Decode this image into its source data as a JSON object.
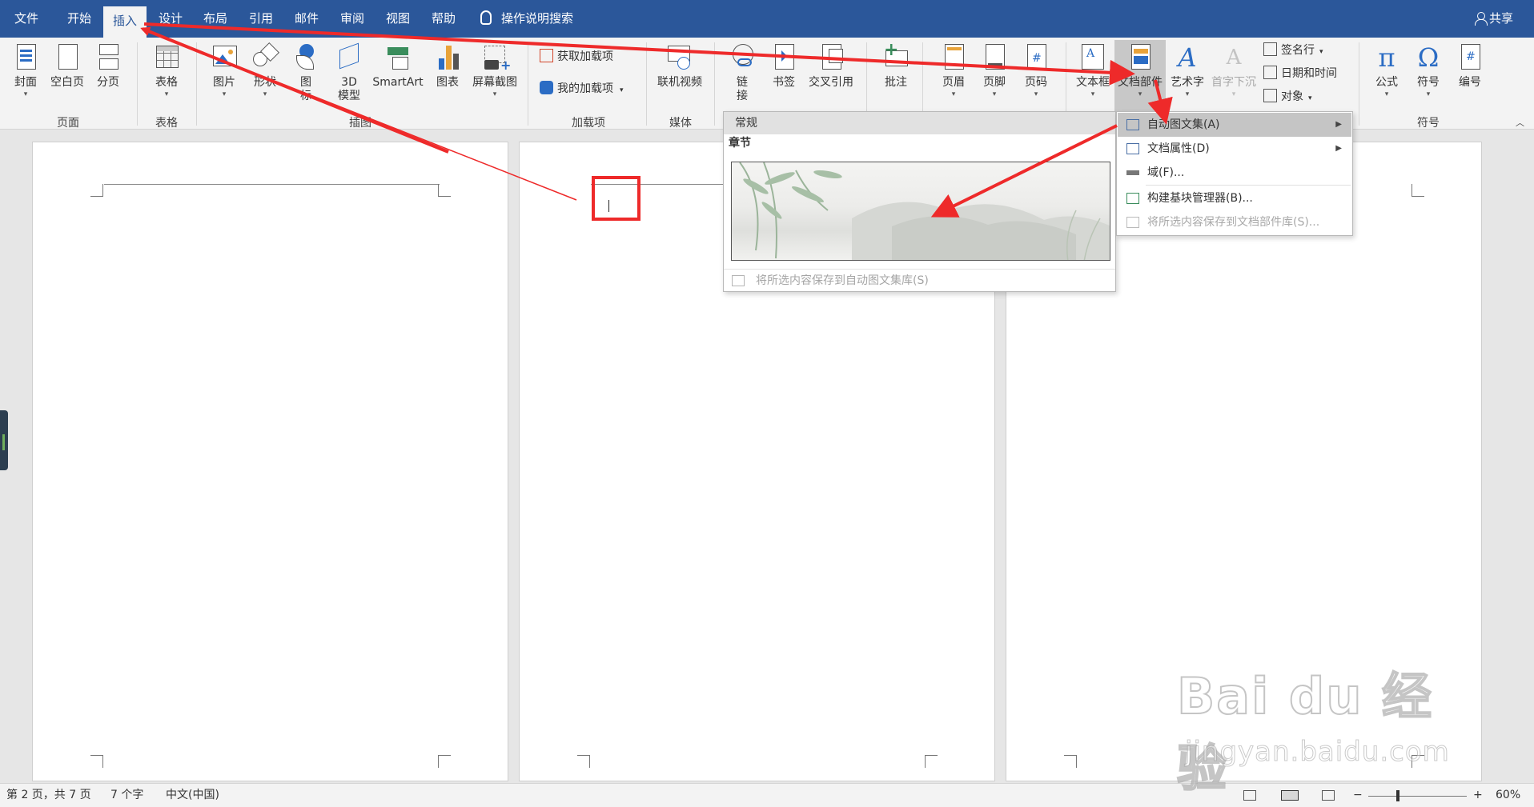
{
  "tabs": [
    {
      "label": "文件",
      "active": false
    },
    {
      "label": "开始",
      "active": false
    },
    {
      "label": "插入",
      "active": true
    },
    {
      "label": "设计",
      "active": false
    },
    {
      "label": "布局",
      "active": false
    },
    {
      "label": "引用",
      "active": false
    },
    {
      "label": "邮件",
      "active": false
    },
    {
      "label": "审阅",
      "active": false
    },
    {
      "label": "视图",
      "active": false
    },
    {
      "label": "帮助",
      "active": false
    }
  ],
  "search_label": "操作说明搜索",
  "share_label": "共享",
  "ribbon": {
    "groups": [
      "页面",
      "表格",
      "插图",
      "加载项",
      "媒体",
      "符号"
    ],
    "buttons": {
      "cover": "封面",
      "blank": "空白页",
      "pagebreak": "分页",
      "table": "表格",
      "picture": "图片",
      "shapes": "形状",
      "icons": "图标",
      "model3d": "3D模型",
      "smartart": "SmartArt",
      "chart": "图表",
      "screenshot": "屏幕截图",
      "get_addins": "获取加载项",
      "my_addins": "我的加载项",
      "online_video": "联机视频",
      "link": "链接",
      "bookmark": "书签",
      "crossref": "交叉引用",
      "comment": "批注",
      "header": "页眉",
      "footer": "页脚",
      "pagenum": "页码",
      "textbox": "文本框",
      "quickparts": "文档部件",
      "wordart": "艺术字",
      "dropcap": "首字下沉",
      "signature": "签名行",
      "datetime": "日期和时间",
      "object": "对象",
      "equation": "公式",
      "symbol": "符号",
      "number": "编号"
    }
  },
  "gallery": {
    "header": "常规",
    "section": "章节",
    "footer_action": "将所选内容保存到自动图文集库(S)"
  },
  "context_menu": [
    {
      "label": "自动图文集(A)",
      "submenu": true,
      "highlighted": true,
      "disabled": false
    },
    {
      "label": "文档属性(D)",
      "submenu": true,
      "highlighted": false,
      "disabled": false
    },
    {
      "label": "域(F)...",
      "submenu": false,
      "highlighted": false,
      "disabled": false
    },
    {
      "label": "构建基块管理器(B)...",
      "submenu": false,
      "highlighted": false,
      "disabled": false
    },
    {
      "label": "将所选内容保存到文档部件库(S)...",
      "submenu": false,
      "highlighted": false,
      "disabled": true
    }
  ],
  "status": {
    "page": "第 2 页，共 7 页",
    "words": "7 个字",
    "language": "中文(中国)",
    "zoom_minus": "−",
    "zoom_plus": "+",
    "zoom": "60%"
  },
  "watermark": {
    "brand": "Bai du 经验",
    "url": "jingyan.baidu.com"
  },
  "colors": {
    "accent": "#2b579a",
    "annotation": "#ee2a2a",
    "menu_highlight": "#c5c5c5"
  }
}
